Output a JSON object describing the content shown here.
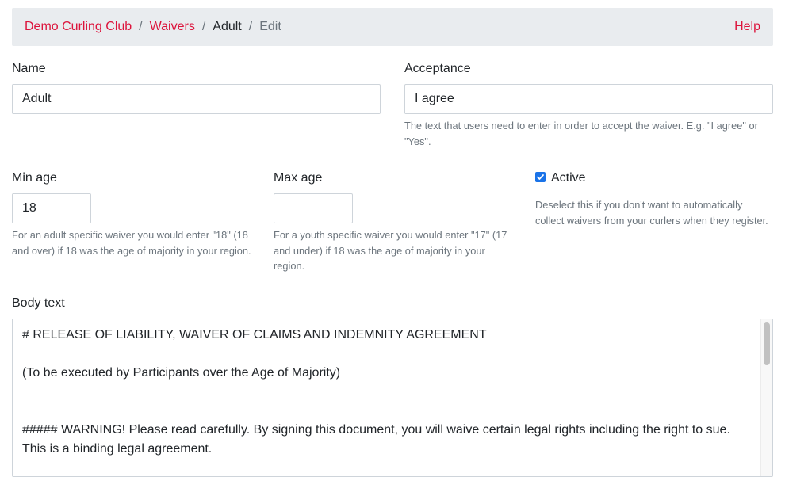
{
  "breadcrumb": {
    "club": "Demo Curling Club",
    "waivers": "Waivers",
    "current": "Adult",
    "action": "Edit",
    "separator": "/",
    "help": "Help"
  },
  "form": {
    "name": {
      "label": "Name",
      "value": "Adult"
    },
    "acceptance": {
      "label": "Acceptance",
      "value": "I agree",
      "help": "The text that users need to enter in order to accept the waiver. E.g. \"I agree\" or \"Yes\"."
    },
    "min_age": {
      "label": "Min age",
      "value": "18",
      "help": "For an adult specific waiver you would enter \"18\" (18 and over) if 18 was the age of majority in your region."
    },
    "max_age": {
      "label": "Max age",
      "value": "",
      "help": "For a youth specific waiver you would enter \"17\" (17 and under) if 18 was the age of majority in your region."
    },
    "active": {
      "label": "Active",
      "checked": true,
      "help": "Deselect this if you don't want to automatically collect waivers from your curlers when they register."
    },
    "body": {
      "label": "Body text",
      "value": "# RELEASE OF LIABILITY, WAIVER OF CLAIMS AND INDEMNITY AGREEMENT\n\n(To be executed by Participants over the Age of Majority)\n\n\n##### WARNING! Please read carefully. By signing this document, you will waive certain legal rights including the right to sue. This is a binding legal agreement."
    }
  },
  "colors": {
    "link": "#dc143c",
    "checkbox": "#1a73e8",
    "muted": "#6c757d"
  }
}
